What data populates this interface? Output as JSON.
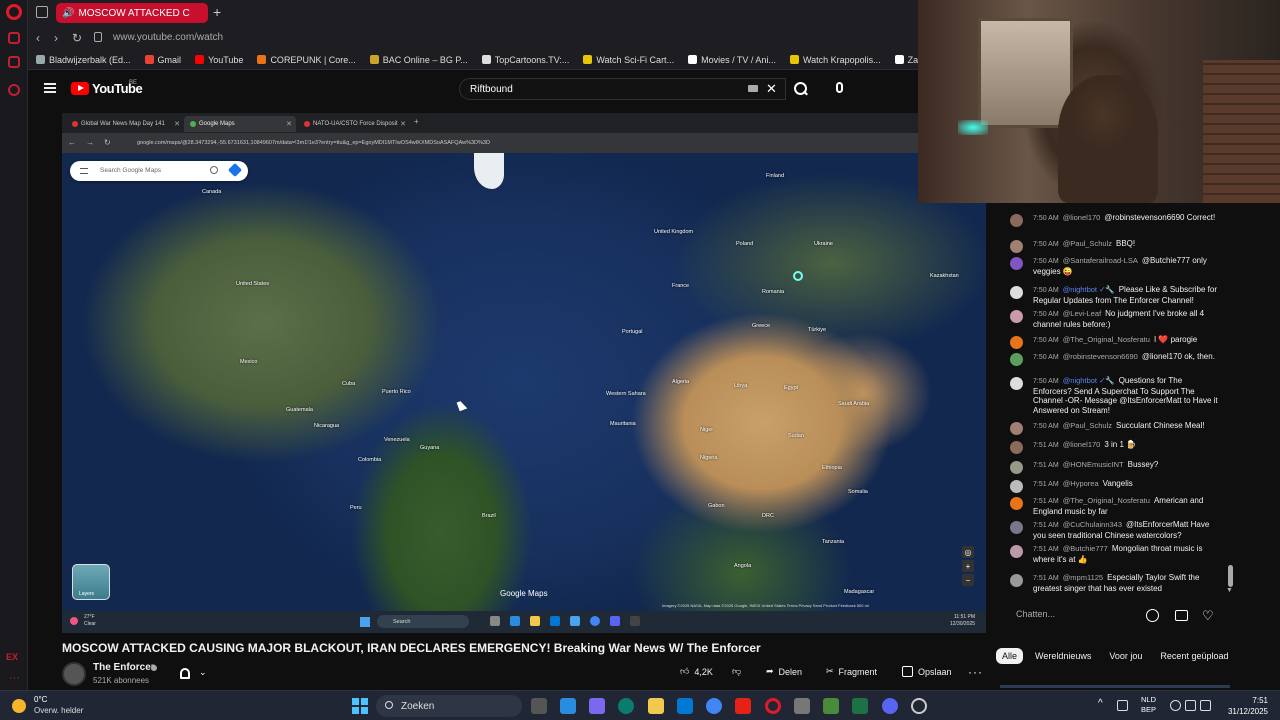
{
  "browser": {
    "active_tab": "MOSCOW ATTACKED C",
    "url": "www.youtube.com/watch",
    "bookmarks": [
      "Bladwijzerbalk (Ed...",
      "Gmail",
      "YouTube",
      "COREPUNK | Core...",
      "BAC Online – BG P...",
      "TopCartoons.TV:...",
      "Watch Sci-Fi Cart...",
      "Movies / TV / Ani...",
      "Watch Krapopolis...",
      "Zamnesia"
    ],
    "side_rail_labels": {
      "ex": "EX",
      "more": "···"
    }
  },
  "youtube": {
    "logo": "YouTube",
    "region": "BE",
    "search_value": "Riftbound"
  },
  "video": {
    "tabs": [
      "Global War News Map Day 141",
      "Google Maps",
      "NATO-UA/CSTO Force Disposit"
    ],
    "url": "google.com/maps/@28.3473294,-55.6731631,10849607m/data=!3m1!1e3?entry=ttu&g_ep=EgoyMDI1MTIwOS4wIKXMDSoASAFQAw%3D%3D",
    "map_search_placeholder": "Search Google Maps",
    "map_labels": [
      {
        "id": "canada",
        "text": "Canada"
      },
      {
        "id": "united-states",
        "text": "United States"
      },
      {
        "id": "mexico",
        "text": "Mexico"
      },
      {
        "id": "cuba",
        "text": "Cuba"
      },
      {
        "id": "puerto-rico",
        "text": "Puerto Rico"
      },
      {
        "id": "guatemala",
        "text": "Guatemala"
      },
      {
        "id": "nicaragua",
        "text": "Nicaragua"
      },
      {
        "id": "venezuela",
        "text": "Venezuela"
      },
      {
        "id": "colombia",
        "text": "Colombia"
      },
      {
        "id": "guyana",
        "text": "Guyana"
      },
      {
        "id": "peru",
        "text": "Peru"
      },
      {
        "id": "brazil",
        "text": "Brazil"
      },
      {
        "id": "finland",
        "text": "Finland"
      },
      {
        "id": "united-kingdom",
        "text": "United Kingdom"
      },
      {
        "id": "poland",
        "text": "Poland"
      },
      {
        "id": "ukraine",
        "text": "Ukraine"
      },
      {
        "id": "france",
        "text": "France"
      },
      {
        "id": "romania",
        "text": "Romania"
      },
      {
        "id": "kazakhstan",
        "text": "Kazakhstan"
      },
      {
        "id": "portugal",
        "text": "Portugal"
      },
      {
        "id": "greece",
        "text": "Greece"
      },
      {
        "id": "turkiye",
        "text": "Türkiye"
      },
      {
        "id": "algeria",
        "text": "Algeria"
      },
      {
        "id": "libya",
        "text": "Libya"
      },
      {
        "id": "egypt",
        "text": "Egypt"
      },
      {
        "id": "saudi-arabia",
        "text": "Saudi Arabia"
      },
      {
        "id": "western-sahara",
        "text": "Western Sahara"
      },
      {
        "id": "mauritania",
        "text": "Mauritania"
      },
      {
        "id": "niger",
        "text": "Niger"
      },
      {
        "id": "sudan",
        "text": "Sudan"
      },
      {
        "id": "nigeria",
        "text": "Nigeria"
      },
      {
        "id": "ethiopia",
        "text": "Ethiopia"
      },
      {
        "id": "somalia",
        "text": "Somalia"
      },
      {
        "id": "gabon",
        "text": "Gabon"
      },
      {
        "id": "drc",
        "text": "DRC"
      },
      {
        "id": "tanzania",
        "text": "Tanzania"
      },
      {
        "id": "angola",
        "text": "Angola"
      },
      {
        "id": "madagascar",
        "text": "Madagascar"
      }
    ],
    "layers_label": "Layers",
    "maps_brand": "Google Maps",
    "attribution": "Imagery ©2025 NASA, Map data ©2025 Google, INEGI   United States   Terms   Privacy   Send Product Feedback   500 mi",
    "taskbar": {
      "temp": "27°F",
      "cond": "Clear",
      "search": "Search",
      "time": "11:51 PM",
      "date": "12/30/2025"
    }
  },
  "title": "MOSCOW ATTACKED CAUSING MAJOR BLACKOUT, IRAN DECLARES EMERGENCY! Breaking War News W/ The Enforcer",
  "channel": {
    "name": "The Enforcer",
    "subs": "521K abonnees"
  },
  "actions": {
    "likes": "4,2K",
    "share": "Delen",
    "clip": "Fragment",
    "save": "Opslaan",
    "more": "···"
  },
  "chat": {
    "messages": [
      {
        "time": "7:50 AM",
        "author": "@lionel170",
        "mod": false,
        "text": "@robinstevenson6690 Correct!",
        "color": "#8a6a5a"
      },
      {
        "time": "7:50 AM",
        "author": "@Paul_Schulz",
        "mod": false,
        "text": "BBQ!",
        "color": "#a08070"
      },
      {
        "time": "7:50 AM",
        "author": "@Santaferailroad-LSA",
        "mod": false,
        "text": "@Butchie777 only veggies 😜",
        "color": "#7e57c2"
      },
      {
        "time": "7:50 AM",
        "author": "@nightbot ✓🔧",
        "mod": true,
        "text": "Please Like & Subscribe for Regular Updates from The Enforcer Channel!",
        "color": "#ddd"
      },
      {
        "time": "7:50 AM",
        "author": "@Levi-Leaf",
        "mod": false,
        "text": "No judgment I've broke all 4 channel rules before:)",
        "color": "#c9a"
      },
      {
        "time": "7:50 AM",
        "author": "@The_Original_Nosferatu",
        "mod": false,
        "text": "I ❤️ parogie",
        "color": "#e8731a"
      },
      {
        "time": "7:50 AM",
        "author": "@robinstevenson6690",
        "mod": false,
        "text": "@lionel170 ok, then.",
        "color": "#5c9e5c"
      },
      {
        "time": "7:50 AM",
        "author": "@nightbot ✓🔧",
        "mod": true,
        "text": "Questions for The Enforcers? Send A Superchat To Support The Channel -OR- Message @ItsEnforcerMatt to Have it Answered on Stream!",
        "color": "#ddd"
      },
      {
        "time": "7:50 AM",
        "author": "@Paul_Schulz",
        "mod": false,
        "text": "Succulant Chinese Meal!",
        "color": "#a08070"
      },
      {
        "time": "7:51 AM",
        "author": "@lionel170",
        "mod": false,
        "text": "3 in 1 🍺",
        "color": "#8a6a5a"
      },
      {
        "time": "7:51 AM",
        "author": "@HONEmusicINT",
        "mod": false,
        "text": "Bussey?",
        "color": "#998"
      },
      {
        "time": "7:51 AM",
        "author": "@Hyporea",
        "mod": false,
        "text": "Vangelis",
        "color": "#bbb"
      },
      {
        "time": "7:51 AM",
        "author": "@The_Original_Nosferatu",
        "mod": false,
        "text": "American and England music by far",
        "color": "#e8731a"
      },
      {
        "time": "7:51 AM",
        "author": "@CuChulainn343",
        "mod": false,
        "text": "@ItsEnforcerMatt Have you seen traditional Chinese watercolors?",
        "color": "#778"
      },
      {
        "time": "7:51 AM",
        "author": "@Butchie777",
        "mod": false,
        "text": "Mongolian throat music is where it's at 👍",
        "color": "#b9a"
      },
      {
        "time": "7:51 AM",
        "author": "@mpm1125",
        "mod": false,
        "text": "Especially Taylor Swift the greatest singer that has ever existed",
        "color": "#999"
      }
    ],
    "input_placeholder": "Chatten..."
  },
  "chips": [
    "Alle",
    "Wereldnieuws",
    "Voor jou",
    "Recent geüpload"
  ],
  "taskbar": {
    "temp": "0°C",
    "weather": "Overw. helder",
    "search": "Zoeken",
    "lang_top": "NLD",
    "lang_bottom": "BEP",
    "time": "7:51",
    "date": "31/12/2025"
  }
}
